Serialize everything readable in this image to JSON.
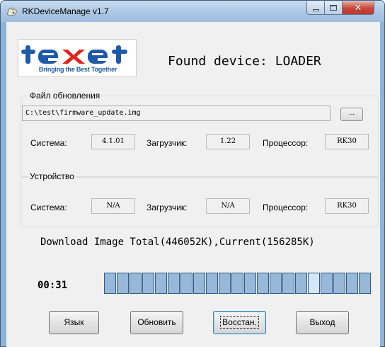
{
  "window": {
    "title": "RKDeviceManage v1.7",
    "controls": {
      "minimize": "minimize",
      "maximize": "maximize",
      "close": "close"
    }
  },
  "logo": {
    "brand": "texet",
    "tagline": "Bringing the Best Together",
    "colors": {
      "brand": "#1f5aa8",
      "accent": "#e2231a"
    }
  },
  "header": {
    "status": "Found device: LOADER"
  },
  "update_file": {
    "title": "Файл обновления",
    "path": "C:\\test\\firmware_update.img",
    "browse_label": "...",
    "system_label": "Система:",
    "system_value": "4.1.01",
    "loader_label": "Загрузчик:",
    "loader_value": "1.22",
    "cpu_label": "Процессор:",
    "cpu_value": "RK30"
  },
  "device": {
    "title": "Устройство",
    "system_label": "Система:",
    "system_value": "N/A",
    "loader_label": "Загрузчик:",
    "loader_value": "N/A",
    "cpu_label": "Процессор:",
    "cpu_value": "RK30"
  },
  "progress": {
    "message": "Download Image Total(446052K),Current(156285K)",
    "elapsed": "00:31",
    "segments_total": 21,
    "highlighted_segment": 17
  },
  "buttons": {
    "language": "Язык",
    "refresh": "Обновить",
    "restore": "Восстан.",
    "exit": "Выход"
  }
}
